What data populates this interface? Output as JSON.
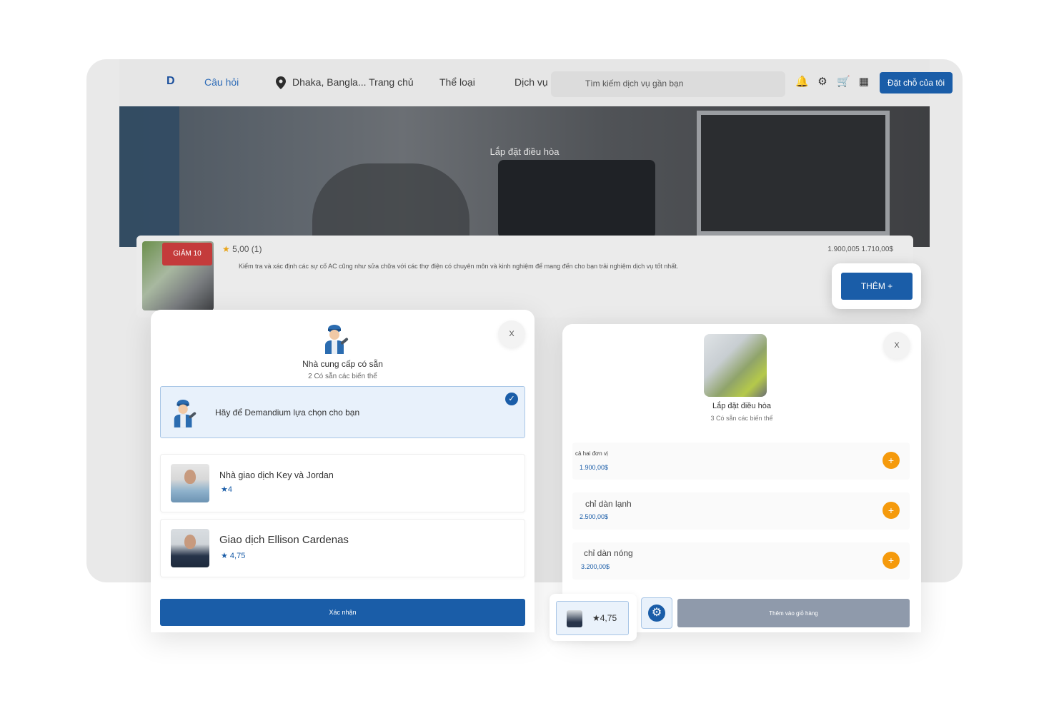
{
  "topbar": {
    "nav_questions": "Câu hỏi",
    "location": "Dhaka, Bangla... Trang chủ",
    "categories": "Thể loại",
    "services": "Dịch vụ Q",
    "search_placeholder": "Tìm kiếm dịch vụ gần bạn",
    "book_button": "Đặt chỗ của tôi"
  },
  "hero": {
    "title": "Lắp đặt điều hòa"
  },
  "service_card": {
    "discount": "GIẢM 10",
    "rating": "5,00 (1)",
    "description": "Kiểm tra và xác định các sự cố AC cũng như sửa chữa với các thợ điện có chuyên môn và kinh nghiệm để mang đến cho bạn trải nghiệm dịch vụ tốt nhất.",
    "price": "1.900,005 1.710,00$",
    "add_button": "THÊM +"
  },
  "provider_modal": {
    "close": "X",
    "title": "Nhà cung cấp có sẵn",
    "subtitle": "2 Có sẵn các biến thể",
    "auto_option": "Hãy để Demandium lựa chọn cho bạn",
    "providers": [
      {
        "name": "Nhà giao dịch Key và Jordan",
        "rating": "★4"
      },
      {
        "name": "Giao dịch Ellison Cardenas",
        "rating": "★ 4,75"
      }
    ],
    "confirm": "Xác nhận"
  },
  "variant_modal": {
    "close": "X",
    "title": "Lắp đặt điều hòa",
    "subtitle": "3 Có sẵn các biến thể",
    "variants": [
      {
        "name": "cả hai đơn vị",
        "price": "1.900,00$"
      },
      {
        "name": "chỉ dàn lạnh",
        "price": "2.500,00$"
      },
      {
        "name": "chỉ dàn nóng",
        "price": "3.200,00$"
      }
    ],
    "selected_rating": "★4,75",
    "add_to_cart": "Thêm vào giỏ hàng"
  },
  "colors": {
    "primary": "#1a5da8",
    "accent": "#f59a0c",
    "discount": "#c43b3b"
  }
}
